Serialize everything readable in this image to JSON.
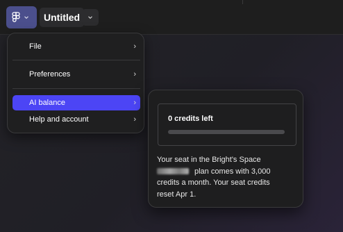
{
  "app": {
    "file_title": "Untitled",
    "main_menu_icon": "figma-logo-icon",
    "menu_chevron_icon": "chevron-down-icon",
    "title_chevron_icon": "chevron-down-icon"
  },
  "menu": {
    "items": [
      {
        "label": "File",
        "arrow": "›"
      },
      {
        "label": "Preferences",
        "arrow": "›"
      },
      {
        "label": "AI balance",
        "arrow": "›"
      },
      {
        "label": "Help and account",
        "arrow": "›"
      }
    ],
    "active_item": "AI balance",
    "active_color": "#4c45f5"
  },
  "ai_balance": {
    "credits_label": "0 credits left",
    "credits_remaining_fraction": 0,
    "description_line1": "Your seat in the Bright's Space",
    "description_line2": "plan comes with 3,000",
    "description_line3": "credits a month. Your seat credits",
    "description_line4": "reset Apr 1."
  },
  "colors": {
    "menu_button_bg": "#4b4f8c",
    "accent": "#4c45f5"
  }
}
